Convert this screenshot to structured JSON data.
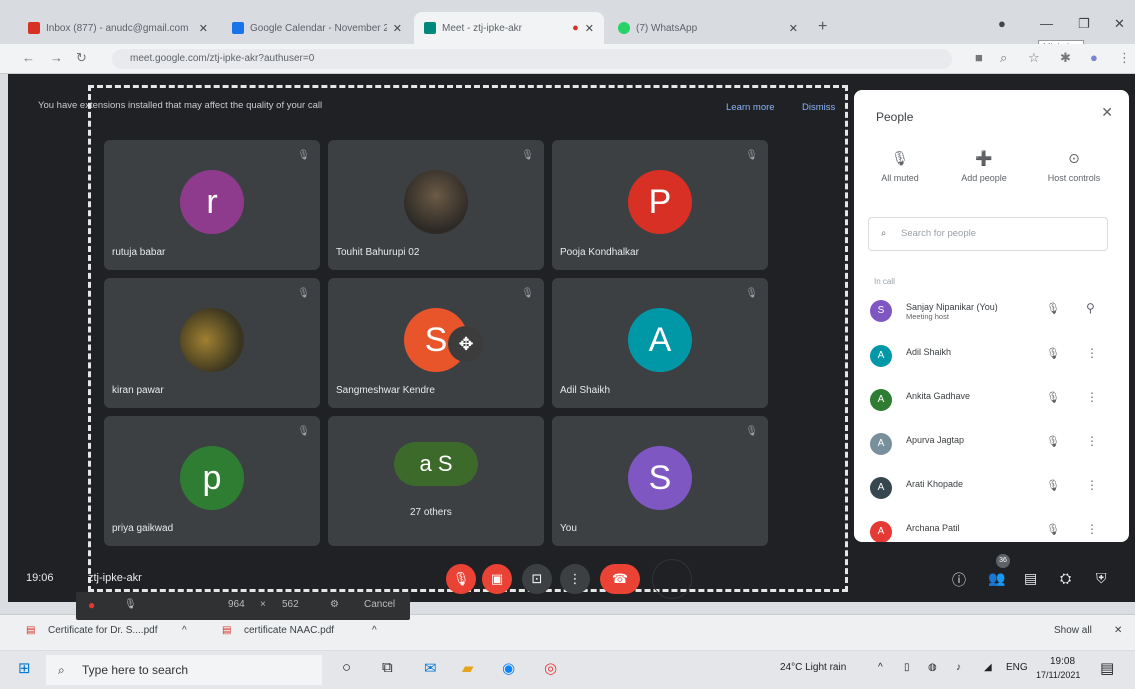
{
  "browser": {
    "tabs": [
      {
        "title": "Inbox (877) - anudc@gmail.com",
        "color": "#d93025",
        "active": false
      },
      {
        "title": "Google Calendar - November 2",
        "color": "#1a73e8",
        "active": false
      },
      {
        "title": "Meet - ztj-ipke-akr",
        "color": "#00897b",
        "active": true
      },
      {
        "title": "(7) WhatsApp",
        "color": "#25d366",
        "active": false
      }
    ],
    "new_tab": "+",
    "url": "meet.google.com/ztj-ipke-akr?authuser=0",
    "tooltip": "Minimize"
  },
  "meet": {
    "banner": "You have extensions installed that may affect the quality of your call",
    "learn_more": "Learn more",
    "dismiss": "Dismiss",
    "tiles": [
      {
        "name": "rutuja babar",
        "initial": "r",
        "color": "#8e3b8e"
      },
      {
        "name": "Touhit Bahurupi 02",
        "initial": "",
        "color": "#5a5a5a"
      },
      {
        "name": "Pooja Kondhalkar",
        "initial": "P",
        "color": "#d93025"
      },
      {
        "name": "kiran pawar",
        "initial": "",
        "color": "#3a3520"
      },
      {
        "name": "Sangmeshwar Kendre",
        "initial": "S",
        "color": "#e8552b"
      },
      {
        "name": "Adil Shaikh",
        "initial": "A",
        "color": "#0097a7"
      },
      {
        "name": "priya gaikwad",
        "initial": "p",
        "color": "#2e7d32"
      },
      {
        "name": "27 others",
        "initial": "a S",
        "color": "#3c6a2a"
      },
      {
        "name": "You",
        "initial": "S",
        "color": "#7e57c2"
      }
    ],
    "time": "19:06",
    "meeting_code": "ztj-ipke-akr",
    "participant_count": "36"
  },
  "people": {
    "title": "People",
    "actions": [
      "All muted",
      "Add people",
      "Host controls"
    ],
    "search_placeholder": "Search for people",
    "section": "In call",
    "list": [
      {
        "name": "Sanjay Nipanikar (You)",
        "sub": "Meeting host",
        "initial": "S",
        "color": "#7e57c2"
      },
      {
        "name": "Adil Shaikh",
        "sub": "",
        "initial": "A",
        "color": "#0097a7"
      },
      {
        "name": "Ankita Gadhave",
        "sub": "",
        "initial": "A",
        "color": "#2e7d32"
      },
      {
        "name": "Apurva Jagtap",
        "sub": "",
        "initial": "A",
        "color": "#78909c"
      },
      {
        "name": "Arati Khopade",
        "sub": "",
        "initial": "A",
        "color": "#37474f"
      },
      {
        "name": "Archana Patil",
        "sub": "",
        "initial": "A",
        "color": "#e53935"
      }
    ]
  },
  "recorder": {
    "size_w": "964",
    "size_x": "×",
    "size_h": "562",
    "cancel": "Cancel"
  },
  "downloads": {
    "files": [
      "Certificate for Dr. S....pdf",
      "certificate NAAC.pdf"
    ],
    "show_all": "Show all"
  },
  "taskbar": {
    "search": "Type here to search",
    "weather": "24°C  Light rain",
    "lang": "ENG",
    "time": "19:08",
    "date": "17/11/2021"
  }
}
